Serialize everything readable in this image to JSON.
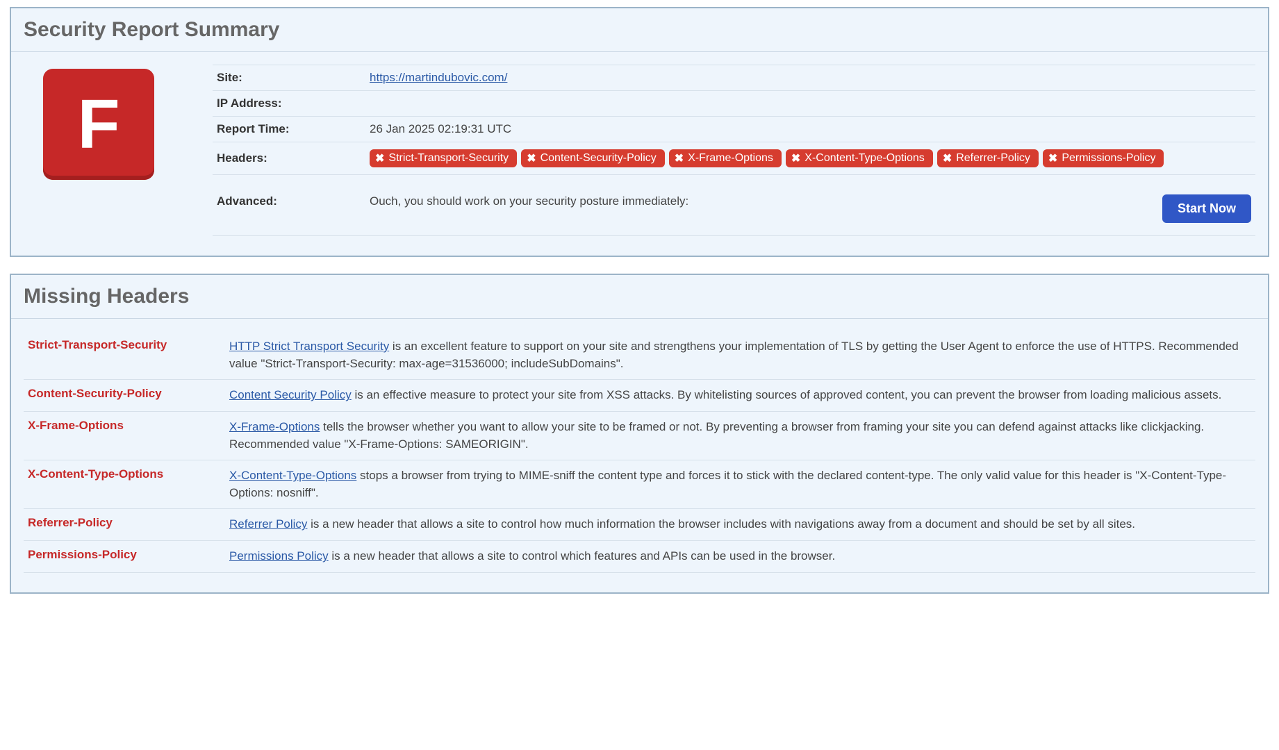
{
  "summary": {
    "title": "Security Report Summary",
    "grade": "F",
    "labels": {
      "site": "Site:",
      "ip": "IP Address:",
      "time": "Report Time:",
      "headers": "Headers:",
      "advanced": "Advanced:"
    },
    "site_url": "https://martindubovic.com/",
    "ip": "",
    "report_time": "26 Jan 2025 02:19:31 UTC",
    "header_badges": [
      "Strict-Transport-Security",
      "Content-Security-Policy",
      "X-Frame-Options",
      "X-Content-Type-Options",
      "Referrer-Policy",
      "Permissions-Policy"
    ],
    "advanced_text": "Ouch, you should work on your security posture immediately:",
    "advanced_button": "Start Now"
  },
  "missing": {
    "title": "Missing Headers",
    "rows": [
      {
        "name": "Strict-Transport-Security",
        "link_text": "HTTP Strict Transport Security",
        "rest": " is an excellent feature to support on your site and strengthens your implementation of TLS by getting the User Agent to enforce the use of HTTPS. Recommended value \"Strict-Transport-Security: max-age=31536000; includeSubDomains\"."
      },
      {
        "name": "Content-Security-Policy",
        "link_text": "Content Security Policy",
        "rest": " is an effective measure to protect your site from XSS attacks. By whitelisting sources of approved content, you can prevent the browser from loading malicious assets."
      },
      {
        "name": "X-Frame-Options",
        "link_text": "X-Frame-Options",
        "rest": " tells the browser whether you want to allow your site to be framed or not. By preventing a browser from framing your site you can defend against attacks like clickjacking. Recommended value \"X-Frame-Options: SAMEORIGIN\"."
      },
      {
        "name": "X-Content-Type-Options",
        "link_text": "X-Content-Type-Options",
        "rest": " stops a browser from trying to MIME-sniff the content type and forces it to stick with the declared content-type. The only valid value for this header is \"X-Content-Type-Options: nosniff\"."
      },
      {
        "name": "Referrer-Policy",
        "link_text": "Referrer Policy",
        "rest": " is a new header that allows a site to control how much information the browser includes with navigations away from a document and should be set by all sites."
      },
      {
        "name": "Permissions-Policy",
        "link_text": "Permissions Policy",
        "rest": " is a new header that allows a site to control which features and APIs can be used in the browser."
      }
    ]
  }
}
